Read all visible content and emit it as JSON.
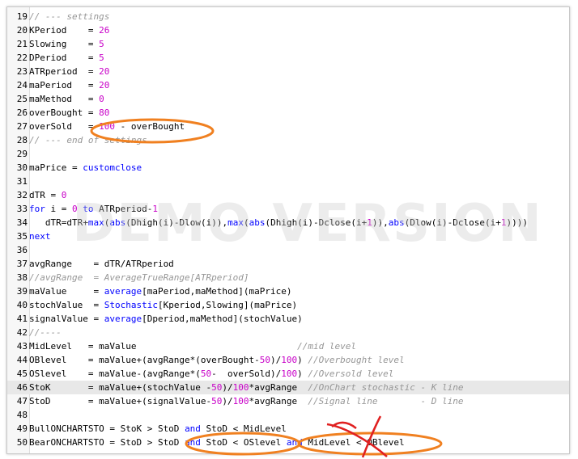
{
  "watermark": "DEMO VERSION",
  "annotation_colors": {
    "ellipse": "#f08020",
    "cross": "#e02020"
  },
  "lines": [
    {
      "n": "19",
      "tokens": [
        [
          "cm",
          "// --- settings"
        ]
      ]
    },
    {
      "n": "20",
      "tokens": [
        [
          "t",
          "KPeriod    = "
        ],
        [
          "num",
          "26"
        ]
      ]
    },
    {
      "n": "21",
      "tokens": [
        [
          "t",
          "Slowing    = "
        ],
        [
          "num",
          "5"
        ]
      ]
    },
    {
      "n": "22",
      "tokens": [
        [
          "t",
          "DPeriod    = "
        ],
        [
          "num",
          "5"
        ]
      ]
    },
    {
      "n": "23",
      "tokens": [
        [
          "t",
          "ATRperiod  = "
        ],
        [
          "num",
          "20"
        ]
      ]
    },
    {
      "n": "24",
      "tokens": [
        [
          "t",
          "maPeriod   = "
        ],
        [
          "num",
          "20"
        ]
      ]
    },
    {
      "n": "25",
      "tokens": [
        [
          "t",
          "maMethod   = "
        ],
        [
          "num",
          "0"
        ]
      ]
    },
    {
      "n": "26",
      "tokens": [
        [
          "t",
          "overBought = "
        ],
        [
          "num",
          "80"
        ]
      ]
    },
    {
      "n": "27",
      "tokens": [
        [
          "t",
          "overSold   = "
        ],
        [
          "num",
          "100"
        ],
        [
          "t",
          " - overBought"
        ]
      ]
    },
    {
      "n": "28",
      "tokens": [
        [
          "cm",
          "// --- end of settings"
        ]
      ]
    },
    {
      "n": "29",
      "tokens": []
    },
    {
      "n": "30",
      "tokens": [
        [
          "t",
          "maPrice = "
        ],
        [
          "fn",
          "customclose"
        ]
      ]
    },
    {
      "n": "31",
      "tokens": []
    },
    {
      "n": "32",
      "tokens": [
        [
          "t",
          "dTR = "
        ],
        [
          "num",
          "0"
        ]
      ]
    },
    {
      "n": "33",
      "tokens": [
        [
          "kw",
          "for"
        ],
        [
          "t",
          " i = "
        ],
        [
          "num",
          "0"
        ],
        [
          "t",
          " "
        ],
        [
          "kw",
          "to"
        ],
        [
          "t",
          " ATRperiod-"
        ],
        [
          "num",
          "1"
        ]
      ]
    },
    {
      "n": "34",
      "tokens": [
        [
          "t",
          "   dTR=dTR+"
        ],
        [
          "fn",
          "max"
        ],
        [
          "t",
          "("
        ],
        [
          "fn",
          "abs"
        ],
        [
          "t",
          "(Dhigh(i)-Dlow(i)),"
        ],
        [
          "fn",
          "max"
        ],
        [
          "t",
          "("
        ],
        [
          "fn",
          "abs"
        ],
        [
          "t",
          "(Dhigh(i)-Dclose(i+"
        ],
        [
          "num",
          "1"
        ],
        [
          "t",
          ")),"
        ],
        [
          "fn",
          "abs"
        ],
        [
          "t",
          "(Dlow(i)-Dclose(i+"
        ],
        [
          "num",
          "1"
        ],
        [
          "t",
          "))))"
        ]
      ]
    },
    {
      "n": "35",
      "tokens": [
        [
          "kw",
          "next"
        ]
      ]
    },
    {
      "n": "36",
      "tokens": []
    },
    {
      "n": "37",
      "tokens": [
        [
          "t",
          "avgRange    = dTR/ATRperiod"
        ]
      ]
    },
    {
      "n": "38",
      "tokens": [
        [
          "cm",
          "//avgRange  = AverageTrueRange[ATRperiod]"
        ]
      ]
    },
    {
      "n": "39",
      "tokens": [
        [
          "t",
          "maValue     = "
        ],
        [
          "fn",
          "average"
        ],
        [
          "t",
          "[maPeriod,maMethod](maPrice)"
        ]
      ]
    },
    {
      "n": "40",
      "tokens": [
        [
          "t",
          "stochValue  = "
        ],
        [
          "fn",
          "Stochastic"
        ],
        [
          "t",
          "[Kperiod,Slowing](maPrice)"
        ]
      ]
    },
    {
      "n": "41",
      "tokens": [
        [
          "t",
          "signalValue = "
        ],
        [
          "fn",
          "average"
        ],
        [
          "t",
          "[Dperiod,maMethod](stochValue)"
        ]
      ]
    },
    {
      "n": "42",
      "tokens": [
        [
          "cm",
          "//----"
        ]
      ]
    },
    {
      "n": "43",
      "tokens": [
        [
          "t",
          "MidLevel   = maValue                              "
        ],
        [
          "cm",
          "//mid level"
        ]
      ]
    },
    {
      "n": "44",
      "tokens": [
        [
          "t",
          "OBlevel    = maValue+(avgRange*(overBought-"
        ],
        [
          "num",
          "50"
        ],
        [
          "t",
          ")/"
        ],
        [
          "num",
          "100"
        ],
        [
          "t",
          ") "
        ],
        [
          "cm",
          "//Overbought level"
        ]
      ]
    },
    {
      "n": "45",
      "tokens": [
        [
          "t",
          "OSlevel    = maValue-(avgRange*("
        ],
        [
          "num",
          "50"
        ],
        [
          "t",
          "-  overSold)/"
        ],
        [
          "num",
          "100"
        ],
        [
          "t",
          ") "
        ],
        [
          "cm",
          "//Oversold level"
        ]
      ]
    },
    {
      "n": "46",
      "tokens": [
        [
          "t",
          "StoK       = maValue+(stochValue -"
        ],
        [
          "num",
          "50"
        ],
        [
          "t",
          ")/"
        ],
        [
          "num",
          "100"
        ],
        [
          "t",
          "*avgRange  "
        ],
        [
          "cm",
          "//OnChart stochastic - K line"
        ]
      ],
      "highlight": true
    },
    {
      "n": "47",
      "tokens": [
        [
          "t",
          "StoD       = maValue+(signalValue-"
        ],
        [
          "num",
          "50"
        ],
        [
          "t",
          ")/"
        ],
        [
          "num",
          "100"
        ],
        [
          "t",
          "*avgRange  "
        ],
        [
          "cm",
          "//Signal line        - D line"
        ]
      ]
    },
    {
      "n": "48",
      "tokens": []
    },
    {
      "n": "49",
      "tokens": [
        [
          "t",
          "BullONCHARTSTO = StoK > StoD "
        ],
        [
          "kw",
          "and"
        ],
        [
          "t",
          " StoD < MidLevel"
        ]
      ]
    },
    {
      "n": "50",
      "tokens": [
        [
          "t",
          "BearONCHARTSTO = StoD > StoD "
        ],
        [
          "kw",
          "and"
        ],
        [
          "t",
          " StoD < OSlevel "
        ],
        [
          "kw",
          "and"
        ],
        [
          "t",
          " MidLevel < OBlevel"
        ]
      ]
    }
  ]
}
